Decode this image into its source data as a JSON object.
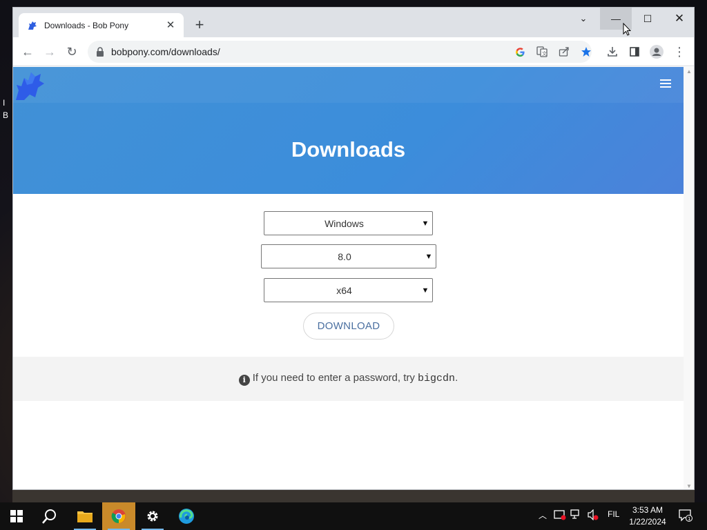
{
  "desktop": {
    "icon_text": "B",
    "icon_initial": "I"
  },
  "browser": {
    "tab": {
      "title": "Downloads - Bob Pony",
      "close_glyph": "✕"
    },
    "new_tab_glyph": "+",
    "window_controls": {
      "tab_search_glyph": "⌄",
      "minimize_glyph": "—",
      "maximize_glyph": "☐",
      "close_glyph": "✕"
    },
    "toolbar": {
      "back_glyph": "←",
      "forward_glyph": "→",
      "reload_glyph": "↻",
      "url": "bobpony.com/downloads/",
      "menu_glyph": "⋮"
    }
  },
  "page": {
    "heading": "Downloads",
    "selects": {
      "os": "Windows",
      "version": "8.0",
      "architecture": "x64"
    },
    "download_label": "DOWNLOAD",
    "notice": {
      "text_before": "If you need to enter a password, try ",
      "password": "bigcdn",
      "text_after": ".",
      "info_glyph": "i"
    }
  },
  "taskbar": {
    "language": "FIL",
    "time": "3:53 AM",
    "date": "1/22/2024",
    "notification_count": "1"
  },
  "colors": {
    "header_gradient_start": "#4191d6",
    "header_gradient_end": "#4b82da",
    "download_text": "#4a6fa0",
    "bookmark_star": "#1a73e8",
    "chrome_task_highlight": "#c98a2a"
  }
}
